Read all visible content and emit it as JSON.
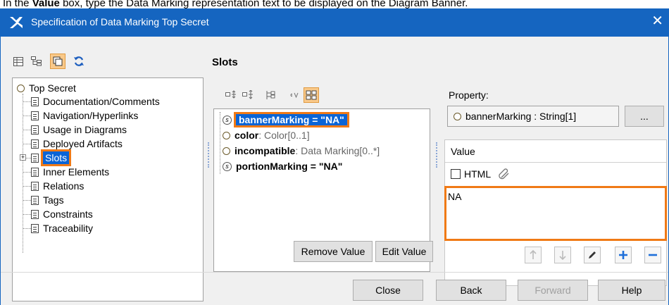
{
  "caption": {
    "prefix": "In the ",
    "bold": "Value",
    "suffix": " box, type the Data Marking representation text to be displayed on the Diagram Banner."
  },
  "window": {
    "title": "Specification of Data Marking Top Secret",
    "close_glyph": "✕",
    "title_bar_color": "#1565c0"
  },
  "toolbar": {
    "icons": [
      "table-icon",
      "tree-icon",
      "window-icon",
      "refresh-icon"
    ]
  },
  "tree": {
    "root": "Top Secret",
    "items": [
      "Documentation/Comments",
      "Navigation/Hyperlinks",
      "Usage in Diagrams",
      "Deployed Artifacts",
      "Slots",
      "Inner Elements",
      "Relations",
      "Tags",
      "Constraints",
      "Traceability"
    ],
    "selected": "Slots"
  },
  "section_title": "Slots",
  "slots": [
    {
      "name": "bannerMarking = \"NA\"",
      "type": "",
      "icon": "slot-icon",
      "selected": true
    },
    {
      "name": "color",
      "type": " : Color[0..1]",
      "icon": "property-icon"
    },
    {
      "name": "incompatible",
      "type": " : Data Marking[0..*]",
      "icon": "property-icon"
    },
    {
      "name": "portionMarking = \"NA\"",
      "type": "",
      "icon": "slot-icon"
    }
  ],
  "slot_buttons": {
    "remove": "Remove Value",
    "edit": "Edit Value"
  },
  "property": {
    "label": "Property:",
    "value": "bannerMarking : String[1]",
    "browse": "..."
  },
  "value_panel": {
    "header": "Value",
    "html_label": "HTML",
    "text": "NA"
  },
  "footer": {
    "close": "Close",
    "back": "Back",
    "forward": "Forward",
    "help": "Help"
  },
  "colors": {
    "accent": "#0a64d6",
    "highlight": "#f07a16"
  }
}
